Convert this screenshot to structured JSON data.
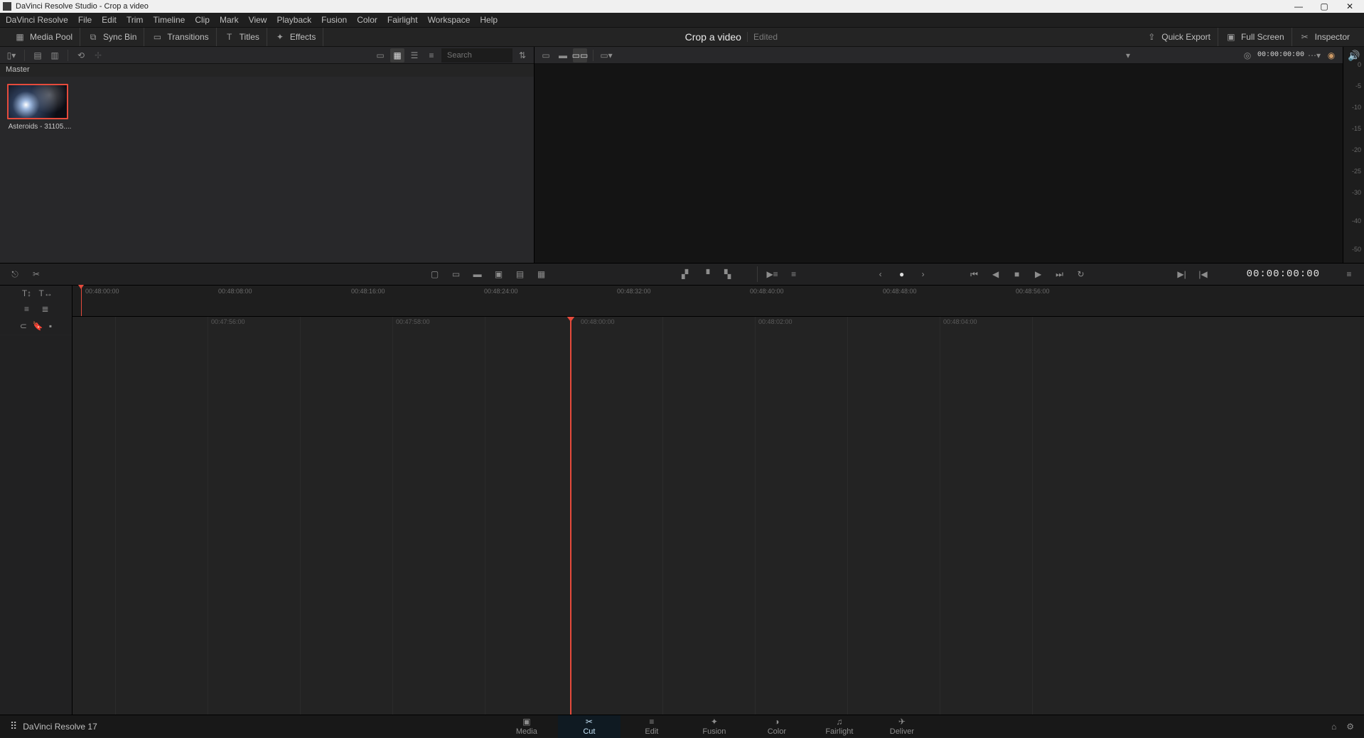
{
  "title": "DaVinci Resolve Studio - Crop a video",
  "menus": [
    "DaVinci Resolve",
    "File",
    "Edit",
    "Trim",
    "Timeline",
    "Clip",
    "Mark",
    "View",
    "Playback",
    "Fusion",
    "Color",
    "Fairlight",
    "Workspace",
    "Help"
  ],
  "topbar": {
    "media_pool": "Media Pool",
    "sync_bin": "Sync Bin",
    "transitions": "Transitions",
    "titles": "Titles",
    "effects": "Effects",
    "project": "Crop a video",
    "project_status": "Edited",
    "quick_export": "Quick Export",
    "full_screen": "Full Screen",
    "inspector": "Inspector"
  },
  "toolrow": {
    "search_placeholder": "Search",
    "tc_small": "00:00:00:00"
  },
  "media": {
    "header": "Master",
    "clips": [
      {
        "name": "Asteroids - 31105...."
      }
    ]
  },
  "meters": {
    "ticks": [
      "0",
      "-5",
      "-10",
      "-15",
      "-20",
      "-25",
      "-30",
      "-40",
      "-50"
    ]
  },
  "transport": {
    "tc": "00:00:00:00"
  },
  "ruler_upper": [
    "00:48:00:00",
    "00:48:08:00",
    "00:48:16:00",
    "00:48:24:00",
    "00:48:32:00",
    "00:48:40:00",
    "00:48:48:00",
    "00:48:56:00"
  ],
  "ruler_lower": [
    "00:47:56:00",
    "00:47:58:00",
    "00:48:00:00",
    "00:48:02:00",
    "00:48:04:00"
  ],
  "pages": {
    "brand": "DaVinci Resolve 17",
    "items": [
      "Media",
      "Cut",
      "Edit",
      "Fusion",
      "Color",
      "Fairlight",
      "Deliver"
    ],
    "active": "Cut"
  }
}
